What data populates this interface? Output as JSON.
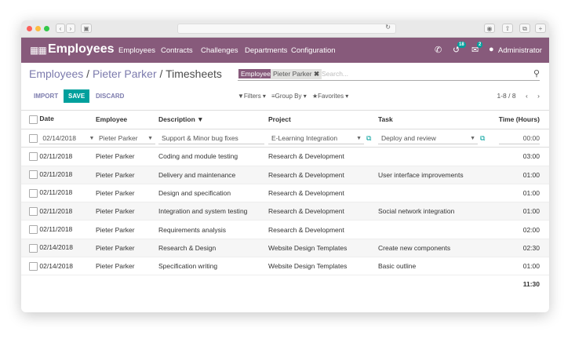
{
  "browser": {
    "url": ""
  },
  "topbar": {
    "app_title": "Employees",
    "menu": [
      "Employees",
      "Contracts",
      "Challenges",
      "Departments",
      "Configuration"
    ],
    "badges": {
      "activity": "18",
      "messages": "2"
    },
    "user": "Administrator"
  },
  "breadcrumb": {
    "root": "Employees",
    "employee": "Pieter Parker",
    "current": "Timesheets"
  },
  "search": {
    "facet_label": "Employee",
    "facet_value": "Pieter Parker",
    "placeholder": "Search..."
  },
  "buttons": {
    "import": "IMPORT",
    "save": "SAVE",
    "discard": "DISCARD"
  },
  "filters": {
    "filters": "Filters",
    "group_by": "Group By",
    "favorites": "Favorites"
  },
  "pager": {
    "value": "1-8 / 8"
  },
  "table": {
    "columns": [
      "Date",
      "Employee",
      "Description",
      "Project",
      "Task",
      "Time (Hours)"
    ],
    "sorted_column": "Description",
    "edit_row": {
      "date": "02/14/2018",
      "employee": "Pieter Parker",
      "description": "Support & Minor bug fixes",
      "project": "E-Learning Integration",
      "task": "Deploy and review",
      "time": "00:00"
    },
    "rows": [
      {
        "date": "02/11/2018",
        "employee": "Pieter Parker",
        "description": "Coding and module testing",
        "project": "Research & Development",
        "task": "",
        "time": "03:00"
      },
      {
        "date": "02/11/2018",
        "employee": "Pieter Parker",
        "description": "Delivery and maintenance",
        "project": "Research & Development",
        "task": "User interface improvements",
        "time": "01:00"
      },
      {
        "date": "02/11/2018",
        "employee": "Pieter Parker",
        "description": "Design and specification",
        "project": "Research & Development",
        "task": "",
        "time": "01:00"
      },
      {
        "date": "02/11/2018",
        "employee": "Pieter Parker",
        "description": "Integration and system testing",
        "project": "Research & Development",
        "task": "Social network integration",
        "time": "01:00"
      },
      {
        "date": "02/11/2018",
        "employee": "Pieter Parker",
        "description": "Requirements analysis",
        "project": "Research & Development",
        "task": "",
        "time": "02:00"
      },
      {
        "date": "02/14/2018",
        "employee": "Pieter Parker",
        "description": "Research & Design",
        "project": "Website Design Templates",
        "task": "Create new components",
        "time": "02:30"
      },
      {
        "date": "02/14/2018",
        "employee": "Pieter Parker",
        "description": "Specification writing",
        "project": "Website Design Templates",
        "task": "Basic outline",
        "time": "01:00"
      }
    ],
    "total": "11:30"
  },
  "colors": {
    "brand": "#875a7b",
    "accent": "#00a09d",
    "link": "#7c7bad"
  }
}
